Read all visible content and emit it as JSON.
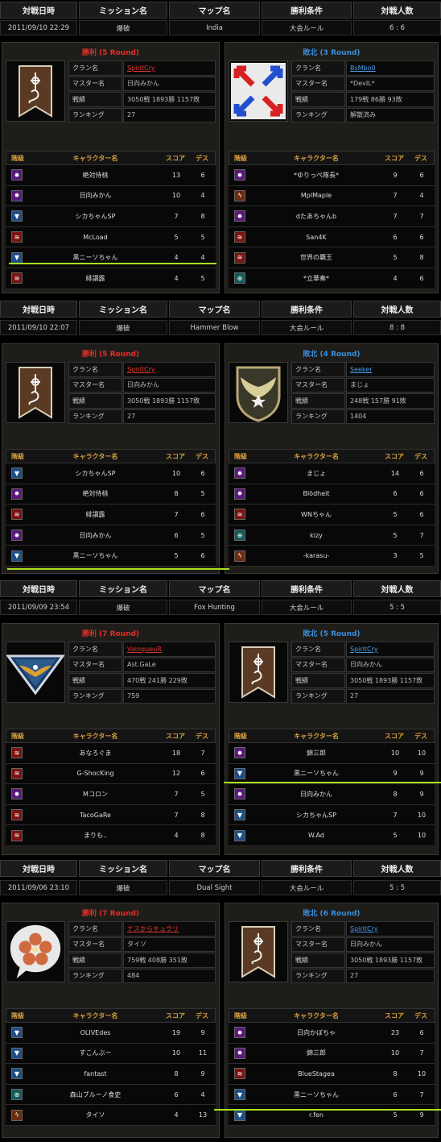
{
  "labels": {
    "date": "対戦日時",
    "mission": "ミッション名",
    "map": "マップ名",
    "rule": "勝利条件",
    "players": "対戦人数",
    "players_first": "対戦日時",
    "clan": "クラン名",
    "master": "マスター名",
    "record": "戦績",
    "ranking": "ランキング",
    "rank": "階級",
    "character": "キャラクター名",
    "score": "スコア",
    "deaths": "デス"
  },
  "matches": [
    {
      "date": "2011/09/10 22:29",
      "mission": "爆破",
      "map": "India",
      "rule": "大会ルール",
      "players": "6 : 6",
      "left": {
        "title": "勝利 (5 Round)",
        "result": "win",
        "clan": "SpiritCry",
        "master": "日向みかん",
        "record": "3050戦 1893勝 1157敗",
        "ranking": "27",
        "emblem": "tos",
        "rows": [
          {
            "rank": "star",
            "rank_icon": "✸",
            "name": "絶対侍桃",
            "score": "13",
            "deaths": "6"
          },
          {
            "rank": "star",
            "rank_icon": "✸",
            "name": "日向みかん",
            "score": "10",
            "deaths": "4"
          },
          {
            "rank": "chevron",
            "rank_icon": "▼",
            "name": "シカちゃんSP",
            "score": "7",
            "deaths": "8"
          },
          {
            "rank": "flame",
            "rank_icon": "≋",
            "name": "McLoad",
            "score": "5",
            "deaths": "5"
          },
          {
            "rank": "chevron",
            "rank_icon": "▼",
            "name": "黒ニーソちゃん",
            "score": "4",
            "deaths": "4"
          },
          {
            "rank": "flame",
            "rank_icon": "≋",
            "name": "緋謂露",
            "score": "4",
            "deaths": "5"
          }
        ]
      },
      "right": {
        "title": "敗北 (3 Round)",
        "result": "lose",
        "clan": "BsMbo0",
        "master": "*DevIL*",
        "record": "179戦 86勝 93敗",
        "ranking": "解散済み",
        "emblem": "arrows",
        "rows": [
          {
            "rank": "star",
            "rank_icon": "✸",
            "name": "*ゆりっぺ隊長*",
            "score": "9",
            "deaths": "6"
          },
          {
            "rank": "bolt",
            "rank_icon": "ϟ",
            "name": "MplMaple",
            "score": "7",
            "deaths": "4"
          },
          {
            "rank": "star",
            "rank_icon": "✸",
            "name": "dたあちゃんb",
            "score": "7",
            "deaths": "7"
          },
          {
            "rank": "flame",
            "rank_icon": "≋",
            "name": "San4K",
            "score": "6",
            "deaths": "6"
          },
          {
            "rank": "flame",
            "rank_icon": "≋",
            "name": "世界の覇王",
            "score": "5",
            "deaths": "8"
          },
          {
            "rank": "teal",
            "rank_icon": "⊕",
            "name": "*立華奏*",
            "score": "4",
            "deaths": "6"
          }
        ]
      }
    },
    {
      "date": "2011/09/10 22:07",
      "mission": "爆破",
      "map": "Hammer Blow",
      "rule": "大会ルール",
      "players": "8 : 8",
      "left": {
        "title": "勝利 (5 Round)",
        "result": "win",
        "clan": "SpiritCry",
        "master": "日向みかん",
        "record": "3050戦 1893勝 1157敗",
        "ranking": "27",
        "emblem": "tos",
        "rows": [
          {
            "rank": "chevron",
            "rank_icon": "▼",
            "name": "シカちゃんSP",
            "score": "10",
            "deaths": "6"
          },
          {
            "rank": "star",
            "rank_icon": "✸",
            "name": "絶対侍桃",
            "score": "8",
            "deaths": "5"
          },
          {
            "rank": "flame",
            "rank_icon": "≋",
            "name": "緋謂露",
            "score": "7",
            "deaths": "6"
          },
          {
            "rank": "star",
            "rank_icon": "✸",
            "name": "日向みかん",
            "score": "6",
            "deaths": "5"
          },
          {
            "rank": "chevron",
            "rank_icon": "▼",
            "name": "黒ニーソちゃん",
            "score": "5",
            "deaths": "6"
          }
        ]
      },
      "right": {
        "title": "敗北 (4 Round)",
        "result": "lose",
        "clan": "Seeker",
        "master": "まじょ",
        "record": "248戦 157勝 91敗",
        "ranking": "1404",
        "emblem": "wings",
        "rows": [
          {
            "rank": "star",
            "rank_icon": "✸",
            "name": "まじょ",
            "score": "14",
            "deaths": "6"
          },
          {
            "rank": "star",
            "rank_icon": "✸",
            "name": "Blödheit",
            "score": "6",
            "deaths": "6"
          },
          {
            "rank": "flame",
            "rank_icon": "≋",
            "name": "WNちゃん",
            "score": "5",
            "deaths": "6"
          },
          {
            "rank": "teal",
            "rank_icon": "⊕",
            "name": "kizy",
            "score": "5",
            "deaths": "7"
          },
          {
            "rank": "bolt",
            "rank_icon": "ϟ",
            "name": "-karasu-",
            "score": "3",
            "deaths": "5"
          }
        ]
      }
    },
    {
      "date": "2011/09/09 23:54",
      "mission": "爆破",
      "map": "Fox Hunting",
      "rule": "大会ルール",
      "players": "5 : 5",
      "left": {
        "title": "勝利 (7 Round)",
        "result": "win",
        "clan": "VainqueuR",
        "master": "Ast.GaLe",
        "record": "470戦 241勝 229敗",
        "ranking": "759",
        "emblem": "eagle",
        "rows": [
          {
            "rank": "flame",
            "rank_icon": "≋",
            "name": "あなろぐま",
            "score": "18",
            "deaths": "7"
          },
          {
            "rank": "flame",
            "rank_icon": "≋",
            "name": "G-ShocKing",
            "score": "12",
            "deaths": "6"
          },
          {
            "rank": "star",
            "rank_icon": "✸",
            "name": "Mコロン",
            "score": "7",
            "deaths": "5"
          },
          {
            "rank": "flame",
            "rank_icon": "≋",
            "name": "TacoGaRe",
            "score": "7",
            "deaths": "8"
          },
          {
            "rank": "flame",
            "rank_icon": "≋",
            "name": "まりも..",
            "score": "4",
            "deaths": "8"
          }
        ]
      },
      "right": {
        "title": "敗北 (5 Round)",
        "result": "lose",
        "clan": "SpiritCry",
        "master": "日向みかん",
        "record": "3050戦 1893勝 1157敗",
        "ranking": "27",
        "emblem": "tos",
        "rows": [
          {
            "rank": "star",
            "rank_icon": "✸",
            "name": "錦三郎",
            "score": "10",
            "deaths": "10"
          },
          {
            "rank": "chevron",
            "rank_icon": "▼",
            "name": "黒ニーソちゃん",
            "score": "9",
            "deaths": "9"
          },
          {
            "rank": "star",
            "rank_icon": "✸",
            "name": "日向みかん",
            "score": "8",
            "deaths": "9"
          },
          {
            "rank": "chevron",
            "rank_icon": "▼",
            "name": "シカちゃんSP",
            "score": "7",
            "deaths": "10"
          },
          {
            "rank": "chevron",
            "rank_icon": "▼",
            "name": "W.Ad",
            "score": "5",
            "deaths": "10"
          }
        ]
      }
    },
    {
      "date": "2011/09/06 23:10",
      "mission": "爆破",
      "map": "Dual Sight",
      "rule": "大会ルール",
      "players": "5 : 5",
      "left": {
        "title": "勝利 (7 Round)",
        "result": "win",
        "clan": "ナスからキュウリ",
        "master": "タイソ",
        "record": "759戦 408勝 351敗",
        "ranking": "484",
        "emblem": "flower",
        "rows": [
          {
            "rank": "chevron",
            "rank_icon": "▼",
            "name": "OLIVEdes",
            "score": "19",
            "deaths": "9"
          },
          {
            "rank": "chevron",
            "rank_icon": "▼",
            "name": "すこんぶー",
            "score": "10",
            "deaths": "11"
          },
          {
            "rank": "chevron",
            "rank_icon": "▼",
            "name": "fantast",
            "score": "8",
            "deaths": "9"
          },
          {
            "rank": "teal",
            "rank_icon": "⊕",
            "name": "森山ブルーノ食史",
            "score": "6",
            "deaths": "4"
          },
          {
            "rank": "bolt",
            "rank_icon": "ϟ",
            "name": "タイソ",
            "score": "4",
            "deaths": "13"
          }
        ]
      },
      "right": {
        "title": "敗北 (6 Round)",
        "result": "lose",
        "clan": "SpiritCry",
        "master": "日向みかん",
        "record": "3050戦 1893勝 1157敗",
        "ranking": "27",
        "emblem": "tos",
        "rows": [
          {
            "rank": "star",
            "rank_icon": "✸",
            "name": "日向かぼちゃ",
            "score": "23",
            "deaths": "6"
          },
          {
            "rank": "star",
            "rank_icon": "✸",
            "name": "錦三郎",
            "score": "10",
            "deaths": "7"
          },
          {
            "rank": "flame",
            "rank_icon": "≋",
            "name": "BlueStagea",
            "score": "8",
            "deaths": "10"
          },
          {
            "rank": "chevron",
            "rank_icon": "▼",
            "name": "黒ニーソちゃん",
            "score": "6",
            "deaths": "7"
          },
          {
            "rank": "chevron",
            "rank_icon": "▼",
            "name": "r.fen",
            "score": "5",
            "deaths": "9"
          }
        ]
      }
    }
  ]
}
